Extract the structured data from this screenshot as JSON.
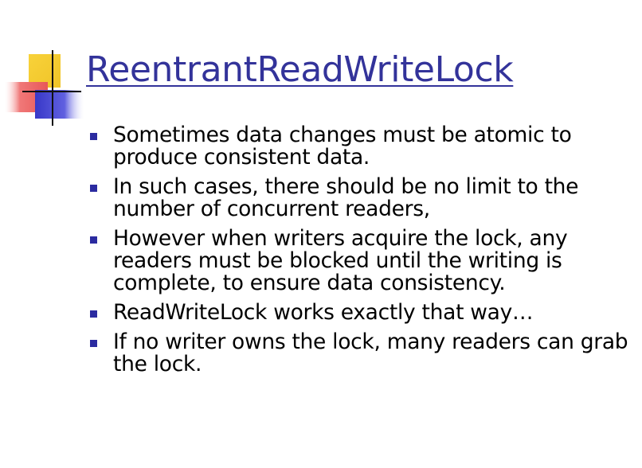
{
  "slide": {
    "title": "ReentrantReadWriteLock",
    "bullets": [
      {
        "text": "Sometimes data changes must be atomic to produce consistent data."
      },
      {
        "text": "In such cases, there should be no limit to the number of concurrent readers,"
      },
      {
        "text": "However when writers acquire the lock, any readers must be blocked until the writing is complete, to ensure data consistency."
      },
      {
        "text": "ReadWriteLock works exactly that way…"
      },
      {
        "text": "If no writer owns the lock, many readers can grab the lock."
      }
    ]
  },
  "colors": {
    "title": "#33339a",
    "bullet_marker": "#2b2ba0",
    "logo_yellow": "#f5cc2e",
    "logo_red": "#f07070",
    "logo_blue": "#4848d8"
  },
  "icons": {
    "logo": "corner-squares-crosshair-logo",
    "bullet": "square-bullet"
  }
}
